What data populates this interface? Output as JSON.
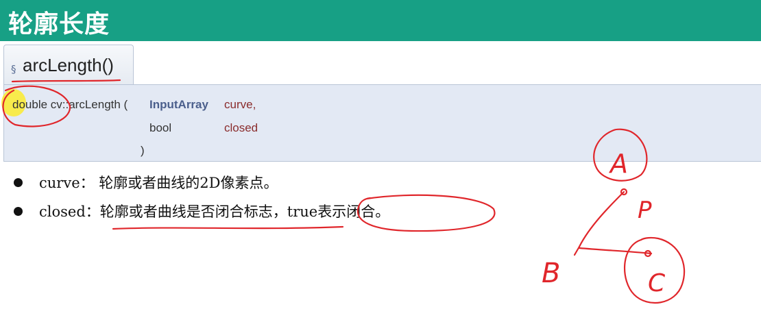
{
  "slide": {
    "title": "轮廓长度"
  },
  "function_tab": {
    "section_mark": "§",
    "name": "arcLength()"
  },
  "signature": {
    "return_and_name": "double cv::arcLength (",
    "param1_type": "InputArray",
    "param1_name": "curve,",
    "param2_type": "bool",
    "param2_name": "closed",
    "closing": ")"
  },
  "bullets": [
    {
      "text": "curve： 轮廓或者曲线的2D像素点。"
    },
    {
      "text": "closed：轮廓或者曲线是否闭合标志，true表示闭合。"
    }
  ],
  "annotations": {
    "label_a": "A",
    "label_p": "P",
    "label_b": "B",
    "label_c": "C"
  },
  "colors": {
    "title_bar": "#17a085",
    "signature_bg": "#e3e9f4",
    "ink": "#e0262b",
    "highlight": "#ffeb14"
  }
}
